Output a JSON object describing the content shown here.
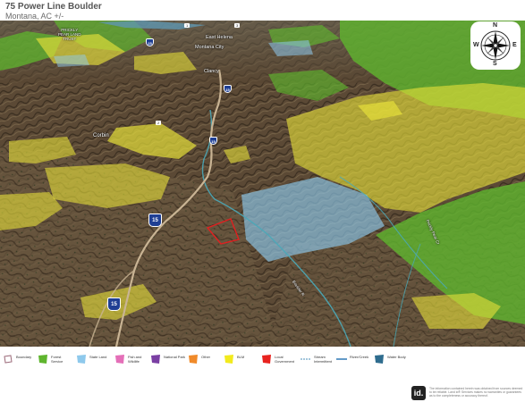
{
  "header": {
    "title": "75 Power Line Boulder",
    "subtitle": "Montana, AC +/-"
  },
  "compass": {
    "n": "N",
    "s": "S",
    "e": "E",
    "w": "W",
    "icon": "compass-rose-icon"
  },
  "map": {
    "place_labels": {
      "prickly_pear": "PRICKLY\nPEAR LAND\nTRUST",
      "east_helena": "East Helena",
      "montana_city": "Montana City",
      "clancy": "Clancy",
      "corbin": "Corbin",
      "boulder_river": "Boulder R",
      "prickly_pear_creek": "Prickly Pear Cr"
    },
    "shields": {
      "i15_top": "15",
      "i15_mid": "15",
      "i15_lower": "15",
      "i15_main": "15",
      "i15_bottom": "15"
    },
    "route_tags": {
      "tag1": "1",
      "tag2": "3",
      "tag3": "2"
    },
    "colors": {
      "forest_service": "#6abf3a",
      "state_land": "#8cc4e8",
      "blm": "#e6e03a",
      "local_government": "#e02020",
      "terrain_dark": "#4a3b2a",
      "terrain_light": "#8b7656"
    }
  },
  "legend": {
    "items": [
      {
        "label": "Boundary",
        "color": "#ffffff",
        "icon": "boundary-icon"
      },
      {
        "label": "Forest\nService",
        "color": "#5fb52e",
        "icon": "swatch"
      },
      {
        "label": "State Land",
        "color": "#8ec9ec",
        "icon": "swatch"
      },
      {
        "label": "Fish and\nWildlife",
        "color": "#e46fb8",
        "icon": "swatch"
      },
      {
        "label": "National Park",
        "color": "#7a3fa3",
        "icon": "swatch"
      },
      {
        "label": "Other",
        "color": "#f08a2a",
        "icon": "swatch"
      },
      {
        "label": "BLM",
        "color": "#f2ea1d",
        "icon": "swatch"
      },
      {
        "label": "Local\nGovernment",
        "color": "#e8231f",
        "icon": "swatch"
      },
      {
        "label": "Stream\nIntermittent",
        "color": "#4a8fb8",
        "icon": "stream-intermittent-icon"
      },
      {
        "label": "River/Creek",
        "color": "#2f79b5",
        "icon": "river-icon"
      },
      {
        "label": "Water Body",
        "color": "#2e6c8e",
        "icon": "swatch"
      }
    ]
  },
  "footer": {
    "logo": "id.",
    "disclaimer": "The information contained herein was obtained from sources deemed to be reliable. Land id® Services makes no warranties or guarantees as to the completeness or accuracy thereof."
  }
}
